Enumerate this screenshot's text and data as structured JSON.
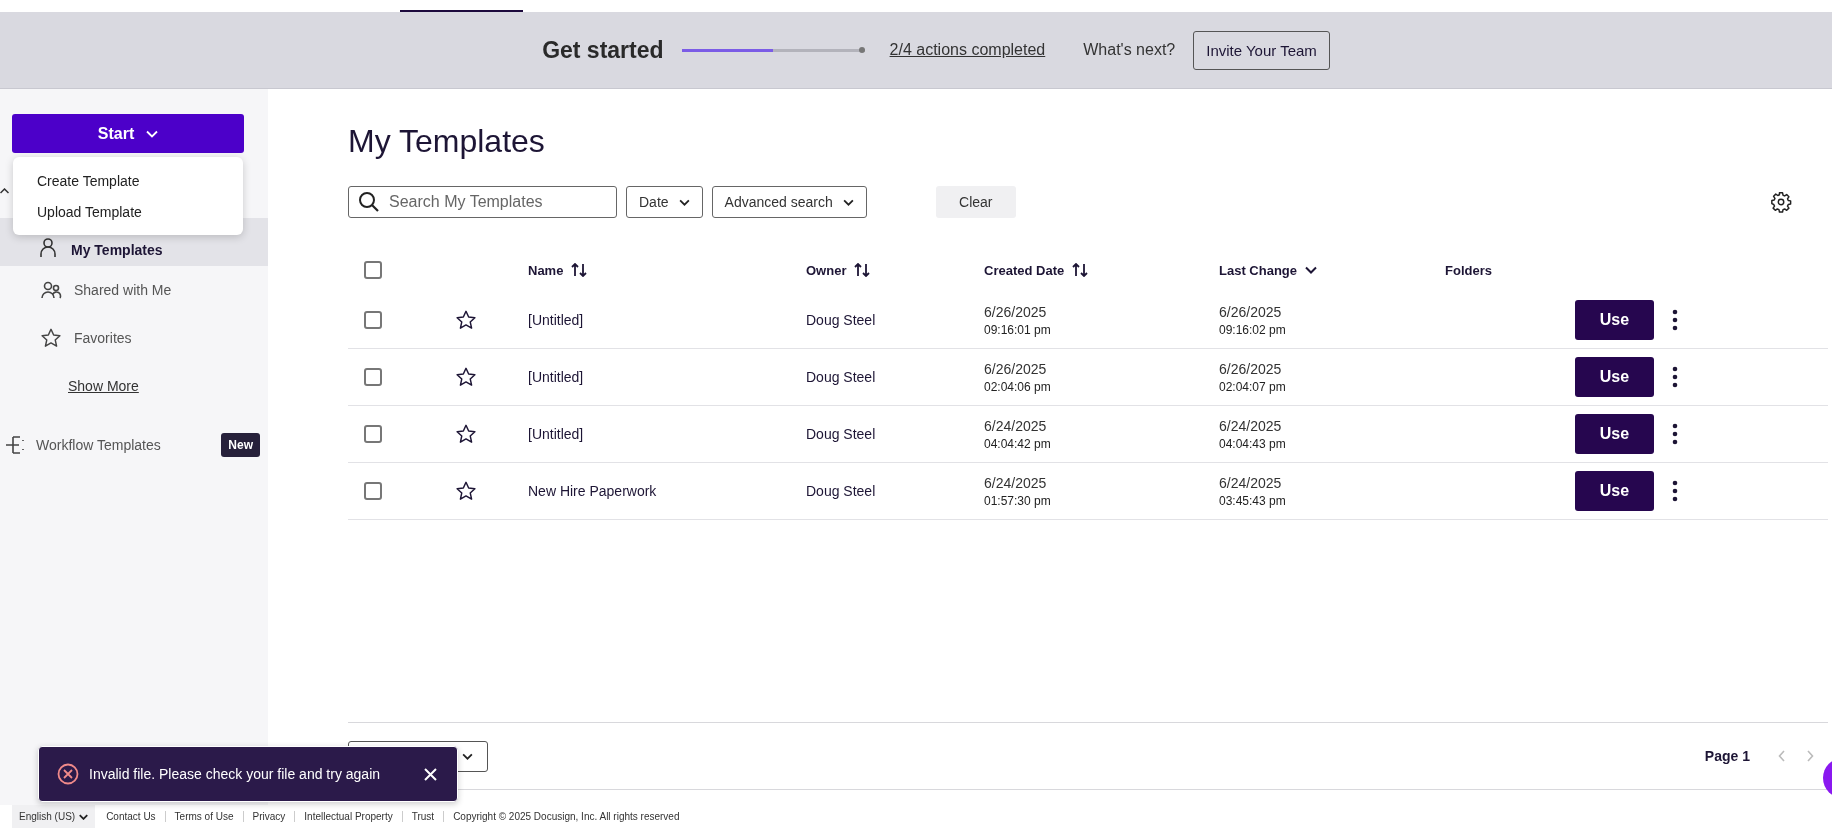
{
  "banner": {
    "title": "Get started",
    "progress": {
      "level": 0.5
    },
    "progress_link": "2/4 actions completed",
    "next_label": "What's next?",
    "invite_button": "Invite Your Team"
  },
  "sidebar": {
    "start_button": "Start",
    "start_menu": {
      "items": [
        "Create Template",
        "Upload Template"
      ]
    },
    "items": [
      {
        "label": "My Templates",
        "selected": true
      },
      {
        "label": "Shared with Me",
        "selected": false
      },
      {
        "label": "Favorites",
        "selected": false
      }
    ],
    "show_more": "Show More",
    "workflow": {
      "label": "Workflow Templates",
      "badge": "New"
    }
  },
  "main": {
    "title": "My Templates",
    "search": {
      "placeholder": "Search My Templates"
    },
    "filters": [
      "Date",
      "Advanced search"
    ],
    "clear_button": "Clear"
  },
  "table": {
    "select_all_checked": false,
    "columns": [
      {
        "label": "Name"
      },
      {
        "label": "Owner"
      },
      {
        "label": "Created Date"
      },
      {
        "label": "Last Change"
      },
      {
        "label": "Folders"
      }
    ],
    "rows": [
      {
        "checked": false,
        "favorite": false,
        "name": "[Untitled]",
        "owner": "Doug Steel",
        "created_date": "6/26/2025",
        "created_time": "09:16:01 pm",
        "changed_date": "6/26/2025",
        "changed_time": "09:16:02 pm",
        "action": "Use"
      },
      {
        "checked": false,
        "favorite": false,
        "name": "[Untitled]",
        "owner": "Doug Steel",
        "created_date": "6/26/2025",
        "created_time": "02:04:06 pm",
        "changed_date": "6/26/2025",
        "changed_time": "02:04:07 pm",
        "action": "Use"
      },
      {
        "checked": false,
        "favorite": false,
        "name": "[Untitled]",
        "owner": "Doug Steel",
        "created_date": "6/24/2025",
        "created_time": "04:04:42 pm",
        "changed_date": "6/24/2025",
        "changed_time": "04:04:43 pm",
        "action": "Use"
      },
      {
        "checked": false,
        "favorite": false,
        "name": "New Hire Paperwork",
        "owner": "Doug Steel",
        "created_date": "6/24/2025",
        "created_time": "01:57:30 pm",
        "changed_date": "6/24/2025",
        "changed_time": "03:45:43 pm",
        "action": "Use"
      }
    ]
  },
  "pagination": {
    "page": "Page 1"
  },
  "toast": {
    "kind": "error",
    "message": "Invalid file. Please check your file and try again"
  },
  "footer": {
    "language": "English (US)",
    "links": [
      "Contact Us",
      "Terms of Use",
      "Privacy",
      "Intellectual Property",
      "Trust"
    ],
    "copyright": "Copyright © 2025 Docusign, Inc. All rights reserved"
  }
}
